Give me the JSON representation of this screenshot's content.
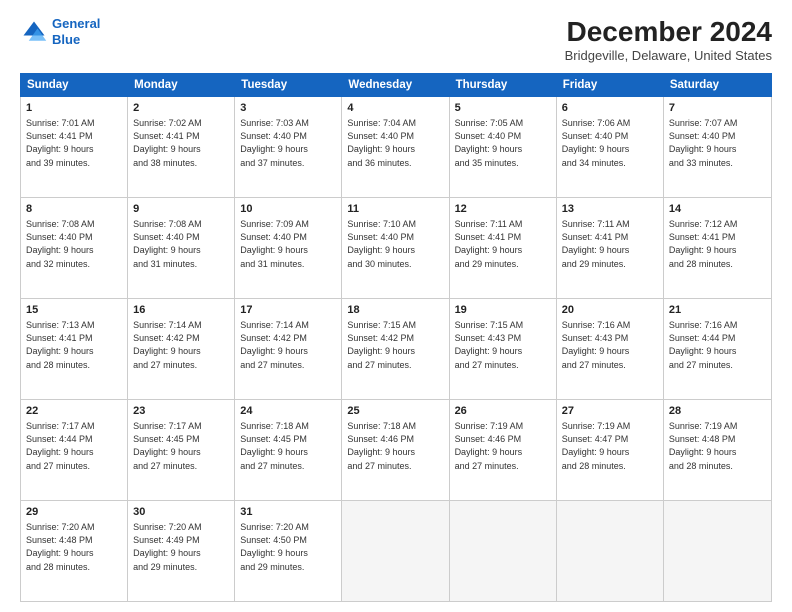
{
  "logo": {
    "line1": "General",
    "line2": "Blue"
  },
  "title": "December 2024",
  "subtitle": "Bridgeville, Delaware, United States",
  "header_days": [
    "Sunday",
    "Monday",
    "Tuesday",
    "Wednesday",
    "Thursday",
    "Friday",
    "Saturday"
  ],
  "weeks": [
    [
      {
        "day": "1",
        "lines": [
          "Sunrise: 7:01 AM",
          "Sunset: 4:41 PM",
          "Daylight: 9 hours",
          "and 39 minutes."
        ]
      },
      {
        "day": "2",
        "lines": [
          "Sunrise: 7:02 AM",
          "Sunset: 4:41 PM",
          "Daylight: 9 hours",
          "and 38 minutes."
        ]
      },
      {
        "day": "3",
        "lines": [
          "Sunrise: 7:03 AM",
          "Sunset: 4:40 PM",
          "Daylight: 9 hours",
          "and 37 minutes."
        ]
      },
      {
        "day": "4",
        "lines": [
          "Sunrise: 7:04 AM",
          "Sunset: 4:40 PM",
          "Daylight: 9 hours",
          "and 36 minutes."
        ]
      },
      {
        "day": "5",
        "lines": [
          "Sunrise: 7:05 AM",
          "Sunset: 4:40 PM",
          "Daylight: 9 hours",
          "and 35 minutes."
        ]
      },
      {
        "day": "6",
        "lines": [
          "Sunrise: 7:06 AM",
          "Sunset: 4:40 PM",
          "Daylight: 9 hours",
          "and 34 minutes."
        ]
      },
      {
        "day": "7",
        "lines": [
          "Sunrise: 7:07 AM",
          "Sunset: 4:40 PM",
          "Daylight: 9 hours",
          "and 33 minutes."
        ]
      }
    ],
    [
      {
        "day": "8",
        "lines": [
          "Sunrise: 7:08 AM",
          "Sunset: 4:40 PM",
          "Daylight: 9 hours",
          "and 32 minutes."
        ]
      },
      {
        "day": "9",
        "lines": [
          "Sunrise: 7:08 AM",
          "Sunset: 4:40 PM",
          "Daylight: 9 hours",
          "and 31 minutes."
        ]
      },
      {
        "day": "10",
        "lines": [
          "Sunrise: 7:09 AM",
          "Sunset: 4:40 PM",
          "Daylight: 9 hours",
          "and 31 minutes."
        ]
      },
      {
        "day": "11",
        "lines": [
          "Sunrise: 7:10 AM",
          "Sunset: 4:40 PM",
          "Daylight: 9 hours",
          "and 30 minutes."
        ]
      },
      {
        "day": "12",
        "lines": [
          "Sunrise: 7:11 AM",
          "Sunset: 4:41 PM",
          "Daylight: 9 hours",
          "and 29 minutes."
        ]
      },
      {
        "day": "13",
        "lines": [
          "Sunrise: 7:11 AM",
          "Sunset: 4:41 PM",
          "Daylight: 9 hours",
          "and 29 minutes."
        ]
      },
      {
        "day": "14",
        "lines": [
          "Sunrise: 7:12 AM",
          "Sunset: 4:41 PM",
          "Daylight: 9 hours",
          "and 28 minutes."
        ]
      }
    ],
    [
      {
        "day": "15",
        "lines": [
          "Sunrise: 7:13 AM",
          "Sunset: 4:41 PM",
          "Daylight: 9 hours",
          "and 28 minutes."
        ]
      },
      {
        "day": "16",
        "lines": [
          "Sunrise: 7:14 AM",
          "Sunset: 4:42 PM",
          "Daylight: 9 hours",
          "and 27 minutes."
        ]
      },
      {
        "day": "17",
        "lines": [
          "Sunrise: 7:14 AM",
          "Sunset: 4:42 PM",
          "Daylight: 9 hours",
          "and 27 minutes."
        ]
      },
      {
        "day": "18",
        "lines": [
          "Sunrise: 7:15 AM",
          "Sunset: 4:42 PM",
          "Daylight: 9 hours",
          "and 27 minutes."
        ]
      },
      {
        "day": "19",
        "lines": [
          "Sunrise: 7:15 AM",
          "Sunset: 4:43 PM",
          "Daylight: 9 hours",
          "and 27 minutes."
        ]
      },
      {
        "day": "20",
        "lines": [
          "Sunrise: 7:16 AM",
          "Sunset: 4:43 PM",
          "Daylight: 9 hours",
          "and 27 minutes."
        ]
      },
      {
        "day": "21",
        "lines": [
          "Sunrise: 7:16 AM",
          "Sunset: 4:44 PM",
          "Daylight: 9 hours",
          "and 27 minutes."
        ]
      }
    ],
    [
      {
        "day": "22",
        "lines": [
          "Sunrise: 7:17 AM",
          "Sunset: 4:44 PM",
          "Daylight: 9 hours",
          "and 27 minutes."
        ]
      },
      {
        "day": "23",
        "lines": [
          "Sunrise: 7:17 AM",
          "Sunset: 4:45 PM",
          "Daylight: 9 hours",
          "and 27 minutes."
        ]
      },
      {
        "day": "24",
        "lines": [
          "Sunrise: 7:18 AM",
          "Sunset: 4:45 PM",
          "Daylight: 9 hours",
          "and 27 minutes."
        ]
      },
      {
        "day": "25",
        "lines": [
          "Sunrise: 7:18 AM",
          "Sunset: 4:46 PM",
          "Daylight: 9 hours",
          "and 27 minutes."
        ]
      },
      {
        "day": "26",
        "lines": [
          "Sunrise: 7:19 AM",
          "Sunset: 4:46 PM",
          "Daylight: 9 hours",
          "and 27 minutes."
        ]
      },
      {
        "day": "27",
        "lines": [
          "Sunrise: 7:19 AM",
          "Sunset: 4:47 PM",
          "Daylight: 9 hours",
          "and 28 minutes."
        ]
      },
      {
        "day": "28",
        "lines": [
          "Sunrise: 7:19 AM",
          "Sunset: 4:48 PM",
          "Daylight: 9 hours",
          "and 28 minutes."
        ]
      }
    ],
    [
      {
        "day": "29",
        "lines": [
          "Sunrise: 7:20 AM",
          "Sunset: 4:48 PM",
          "Daylight: 9 hours",
          "and 28 minutes."
        ]
      },
      {
        "day": "30",
        "lines": [
          "Sunrise: 7:20 AM",
          "Sunset: 4:49 PM",
          "Daylight: 9 hours",
          "and 29 minutes."
        ]
      },
      {
        "day": "31",
        "lines": [
          "Sunrise: 7:20 AM",
          "Sunset: 4:50 PM",
          "Daylight: 9 hours",
          "and 29 minutes."
        ]
      },
      {
        "day": "",
        "lines": []
      },
      {
        "day": "",
        "lines": []
      },
      {
        "day": "",
        "lines": []
      },
      {
        "day": "",
        "lines": []
      }
    ]
  ]
}
